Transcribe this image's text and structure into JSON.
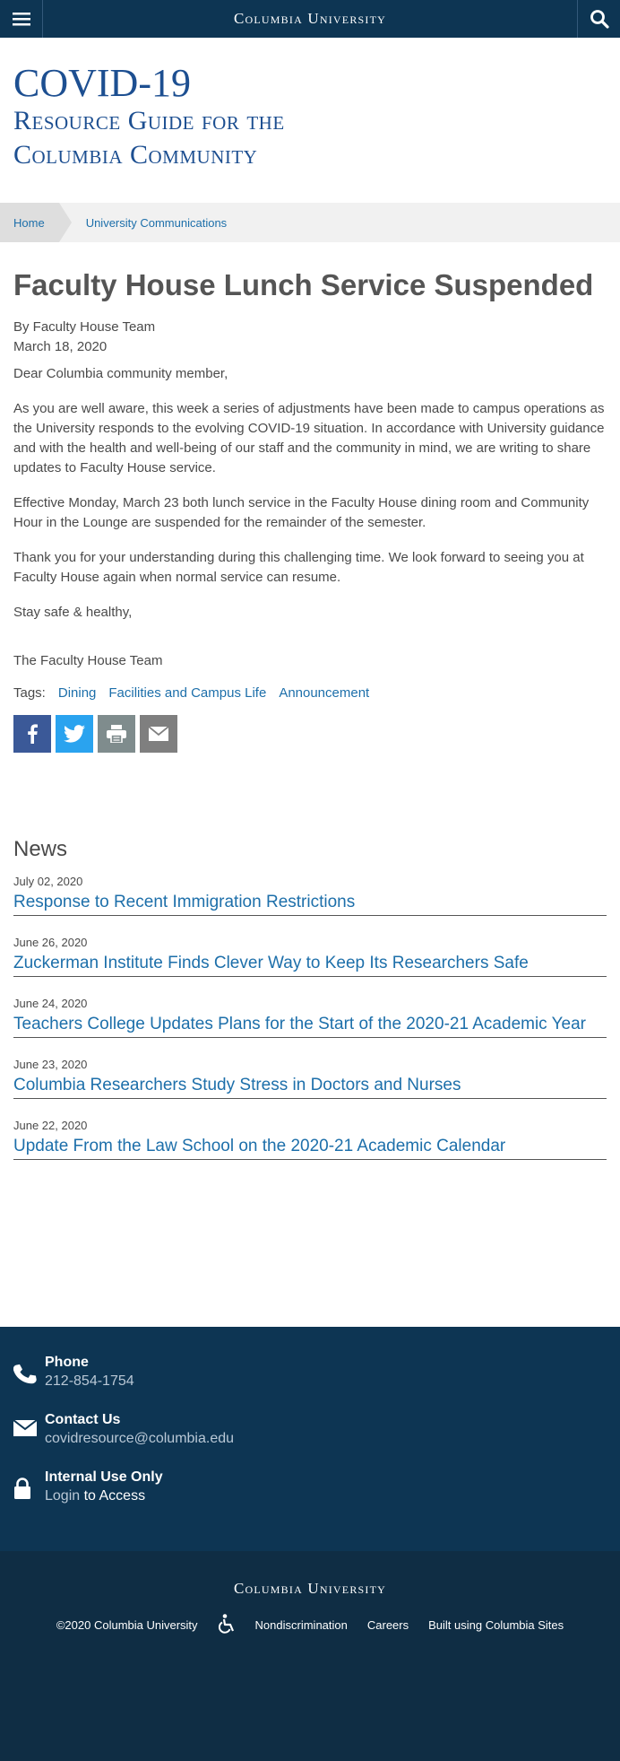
{
  "header": {
    "brand": "Columbia University",
    "menu_icon": "hamburger-icon",
    "search_icon": "search-icon"
  },
  "site_title": {
    "line1": "COVID-19",
    "line2a": "Resource Guide for the",
    "line2b": "Columbia Community"
  },
  "breadcrumb": {
    "home": "Home",
    "current": "University Communications"
  },
  "article": {
    "title": "Faculty House Lunch Service Suspended",
    "byline": "By Faculty House Team",
    "date": "March 18, 2020",
    "greeting": "Dear Columbia community member,",
    "para1": "As you are well aware, this week a series of adjustments have been made to campus operations as the University responds to the evolving COVID-19 situation. In accordance with University guidance and with the health and well-being of our staff and the community in mind, we are writing to share updates to Faculty House service.",
    "para2": "Effective Monday, March 23 both lunch service in the Faculty House dining room and Community Hour in the Lounge are suspended for the remainder of the semester.",
    "para3": "Thank you for your understanding during this challenging time. We look forward to seeing you at Faculty House again when normal service can resume.",
    "closing": "Stay safe & healthy,",
    "signature": "The Faculty House Team"
  },
  "tags": {
    "label": "Tags:",
    "items": [
      "Dining",
      "Facilities and Campus Life",
      "Announcement"
    ]
  },
  "share": {
    "icons": [
      "facebook-icon",
      "twitter-icon",
      "print-icon",
      "email-icon"
    ]
  },
  "news": {
    "heading": "News",
    "items": [
      {
        "date": "July 02, 2020",
        "title": "Response to Recent Immigration Restrictions"
      },
      {
        "date": "June 26, 2020",
        "title": "Zuckerman Institute Finds Clever Way to Keep Its Researchers Safe"
      },
      {
        "date": "June 24, 2020",
        "title": "Teachers College Updates Plans for the Start of the 2020-21 Academic Year"
      },
      {
        "date": "June 23, 2020",
        "title": "Columbia Researchers Study Stress in Doctors and Nurses"
      },
      {
        "date": "June 22, 2020",
        "title": "Update From the Law School on the 2020-21 Academic Calendar"
      }
    ]
  },
  "footer": {
    "phone_label": "Phone",
    "phone_value": "212-854-1754",
    "contact_label": "Contact Us",
    "contact_value": "covidresource@columbia.edu",
    "internal_label": "Internal Use Only",
    "login_link": "Login",
    "login_suffix": " to Access",
    "brand": "Columbia University",
    "copyright": "©2020 Columbia University",
    "nondiscrimination": "Nondiscrimination",
    "careers": "Careers",
    "built": "Built using Columbia Sites"
  },
  "colors": {
    "navy": "#0d3553",
    "link_blue": "#1d6faa",
    "title_blue": "#1d4f91",
    "facebook": "#3b5998",
    "twitter": "#2aa3ef"
  }
}
